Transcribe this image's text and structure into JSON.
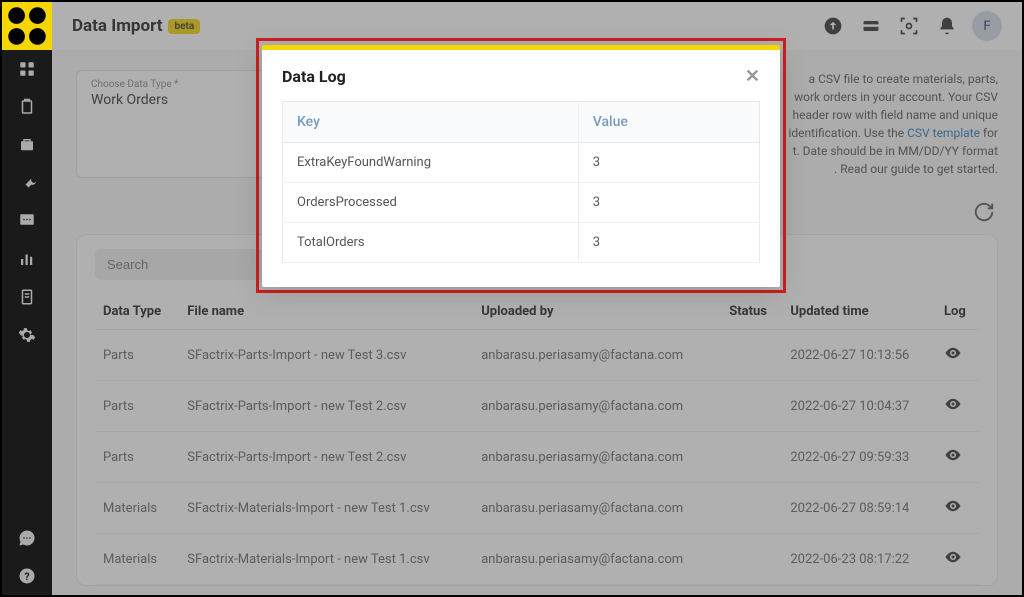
{
  "header": {
    "title": "Data Import",
    "badge": "beta",
    "avatar": "F"
  },
  "select": {
    "label": "Choose Data Type *",
    "value": "Work Orders"
  },
  "info": {
    "line1": "a CSV file to create materials, parts,",
    "line2": "work orders in your account. Your CSV",
    "line3_pre": "header row with field name and unique",
    "line4_pre": "identification. Use the ",
    "link": "CSV template",
    "line4_post": " for",
    "line5": "t. Date should be in MM/DD/YY format",
    "line6": ". Read our guide to get started."
  },
  "search_placeholder": "Search",
  "table": {
    "headers": [
      "Data Type",
      "File name",
      "Uploaded by",
      "Status",
      "Updated time",
      "Log"
    ],
    "rows": [
      {
        "type": "Parts",
        "file": "SFactrix-Parts-Import - new Test 3.csv",
        "by": "anbarasu.periasamy@factana.com",
        "status": "",
        "time": "2022-06-27 10:13:56"
      },
      {
        "type": "Parts",
        "file": "SFactrix-Parts-Import - new Test 2.csv",
        "by": "anbarasu.periasamy@factana.com",
        "status": "",
        "time": "2022-06-27 10:04:37"
      },
      {
        "type": "Parts",
        "file": "SFactrix-Parts-Import - new Test 2.csv",
        "by": "anbarasu.periasamy@factana.com",
        "status": "",
        "time": "2022-06-27 09:59:33"
      },
      {
        "type": "Materials",
        "file": "SFactrix-Materials-Import - new Test 1.csv",
        "by": "anbarasu.periasamy@factana.com",
        "status": "",
        "time": "2022-06-27 08:59:14"
      },
      {
        "type": "Materials",
        "file": "SFactrix-Materials-Import - new Test 1.csv",
        "by": "anbarasu.periasamy@factana.com",
        "status": "",
        "time": "2022-06-23 08:17:22"
      }
    ]
  },
  "modal": {
    "title": "Data Log",
    "key_header": "Key",
    "value_header": "Value",
    "rows": [
      {
        "key": "ExtraKeyFoundWarning",
        "value": "3"
      },
      {
        "key": "OrdersProcessed",
        "value": "3"
      },
      {
        "key": "TotalOrders",
        "value": "3"
      }
    ]
  }
}
